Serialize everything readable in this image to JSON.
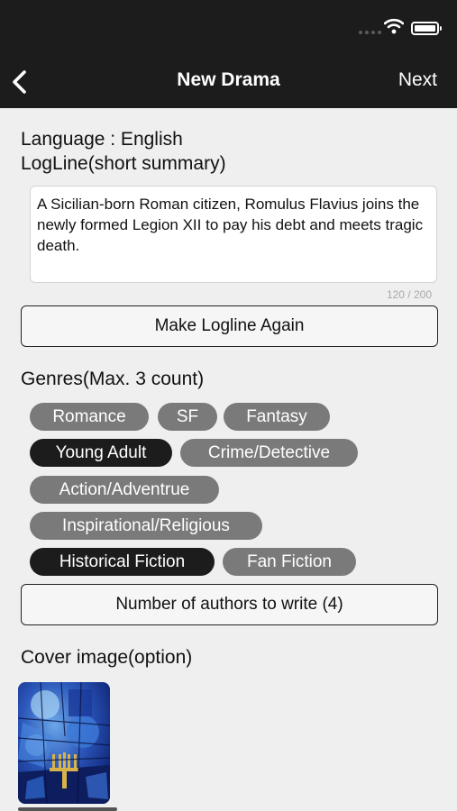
{
  "nav": {
    "title": "New Drama",
    "next_label": "Next"
  },
  "language": {
    "text": "Language : English"
  },
  "logline": {
    "label": "LogLine(short summary)",
    "value": "A Sicilian-born Roman citizen, Romulus Flavius joins the newly formed Legion XII to pay his debt and meets tragic death.",
    "counter": "120 / 200",
    "regenerate_label": "Make Logline Again"
  },
  "genres": {
    "label": "Genres(Max. 3 count)",
    "items": [
      {
        "label": "Romance",
        "selected": false
      },
      {
        "label": "SF",
        "selected": false
      },
      {
        "label": "Fantasy",
        "selected": false
      },
      {
        "label": "Young Adult",
        "selected": true
      },
      {
        "label": "Crime/Detective",
        "selected": false
      },
      {
        "label": "Action/Adventrue",
        "selected": false
      },
      {
        "label": "Inspirational/Religious",
        "selected": false
      },
      {
        "label": "Historical Fiction",
        "selected": true
      },
      {
        "label": "Fan Fiction",
        "selected": false
      }
    ]
  },
  "authors": {
    "button_label": "Number of authors to write (4)"
  },
  "cover": {
    "label": "Cover image(option)"
  },
  "colors": {
    "bar": "#1c1c1c",
    "background": "#efefef",
    "chip": "#7a7a7a",
    "chip_selected": "#1c1c1c"
  }
}
